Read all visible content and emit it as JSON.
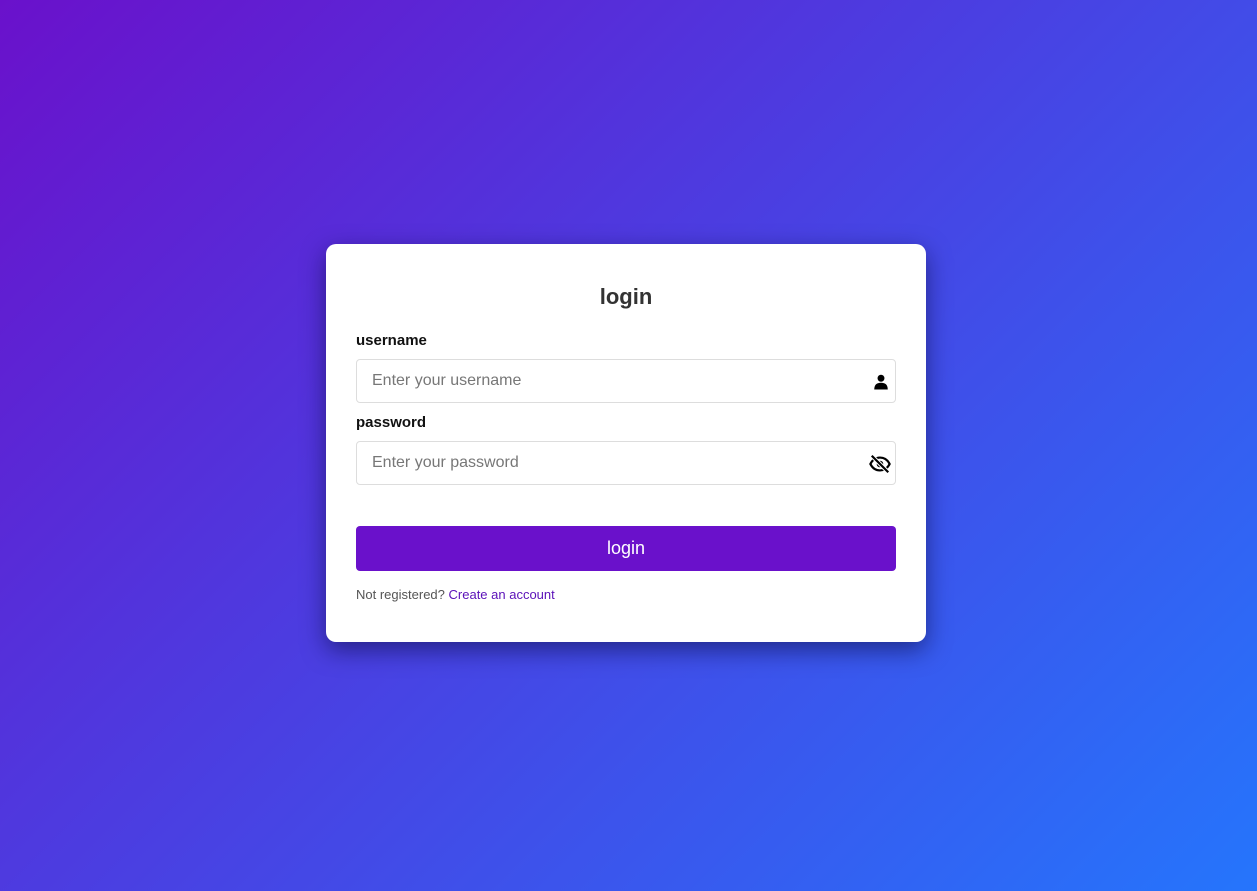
{
  "colors": {
    "gradient_start": "#6a11cb",
    "gradient_end": "#2575fc",
    "button": "#6a11cb",
    "link": "#5a10b8"
  },
  "form": {
    "title": "login",
    "username": {
      "label": "username",
      "value": "",
      "placeholder": "Enter your username",
      "icon": "user-icon"
    },
    "password": {
      "label": "password",
      "value": "",
      "placeholder": "Enter your password",
      "icon": "eye-slash-icon"
    },
    "submit_label": "login",
    "footer": {
      "text": "Not registered?",
      "link_text": "Create an account"
    }
  }
}
